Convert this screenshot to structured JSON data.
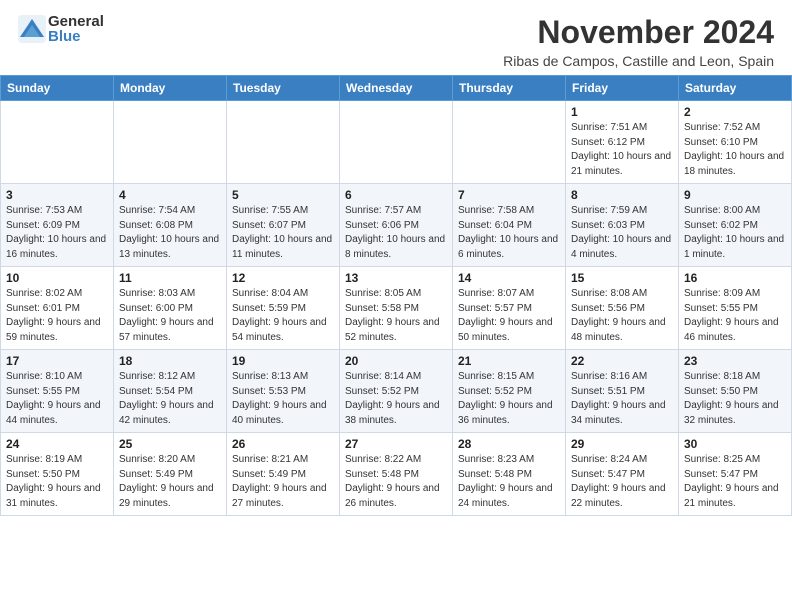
{
  "header": {
    "logo_general": "General",
    "logo_blue": "Blue",
    "month_title": "November 2024",
    "subtitle": "Ribas de Campos, Castille and Leon, Spain"
  },
  "weekdays": [
    "Sunday",
    "Monday",
    "Tuesday",
    "Wednesday",
    "Thursday",
    "Friday",
    "Saturday"
  ],
  "weeks": [
    [
      {
        "day": "",
        "info": ""
      },
      {
        "day": "",
        "info": ""
      },
      {
        "day": "",
        "info": ""
      },
      {
        "day": "",
        "info": ""
      },
      {
        "day": "",
        "info": ""
      },
      {
        "day": "1",
        "info": "Sunrise: 7:51 AM\nSunset: 6:12 PM\nDaylight: 10 hours and 21 minutes."
      },
      {
        "day": "2",
        "info": "Sunrise: 7:52 AM\nSunset: 6:10 PM\nDaylight: 10 hours and 18 minutes."
      }
    ],
    [
      {
        "day": "3",
        "info": "Sunrise: 7:53 AM\nSunset: 6:09 PM\nDaylight: 10 hours and 16 minutes."
      },
      {
        "day": "4",
        "info": "Sunrise: 7:54 AM\nSunset: 6:08 PM\nDaylight: 10 hours and 13 minutes."
      },
      {
        "day": "5",
        "info": "Sunrise: 7:55 AM\nSunset: 6:07 PM\nDaylight: 10 hours and 11 minutes."
      },
      {
        "day": "6",
        "info": "Sunrise: 7:57 AM\nSunset: 6:06 PM\nDaylight: 10 hours and 8 minutes."
      },
      {
        "day": "7",
        "info": "Sunrise: 7:58 AM\nSunset: 6:04 PM\nDaylight: 10 hours and 6 minutes."
      },
      {
        "day": "8",
        "info": "Sunrise: 7:59 AM\nSunset: 6:03 PM\nDaylight: 10 hours and 4 minutes."
      },
      {
        "day": "9",
        "info": "Sunrise: 8:00 AM\nSunset: 6:02 PM\nDaylight: 10 hours and 1 minute."
      }
    ],
    [
      {
        "day": "10",
        "info": "Sunrise: 8:02 AM\nSunset: 6:01 PM\nDaylight: 9 hours and 59 minutes."
      },
      {
        "day": "11",
        "info": "Sunrise: 8:03 AM\nSunset: 6:00 PM\nDaylight: 9 hours and 57 minutes."
      },
      {
        "day": "12",
        "info": "Sunrise: 8:04 AM\nSunset: 5:59 PM\nDaylight: 9 hours and 54 minutes."
      },
      {
        "day": "13",
        "info": "Sunrise: 8:05 AM\nSunset: 5:58 PM\nDaylight: 9 hours and 52 minutes."
      },
      {
        "day": "14",
        "info": "Sunrise: 8:07 AM\nSunset: 5:57 PM\nDaylight: 9 hours and 50 minutes."
      },
      {
        "day": "15",
        "info": "Sunrise: 8:08 AM\nSunset: 5:56 PM\nDaylight: 9 hours and 48 minutes."
      },
      {
        "day": "16",
        "info": "Sunrise: 8:09 AM\nSunset: 5:55 PM\nDaylight: 9 hours and 46 minutes."
      }
    ],
    [
      {
        "day": "17",
        "info": "Sunrise: 8:10 AM\nSunset: 5:55 PM\nDaylight: 9 hours and 44 minutes."
      },
      {
        "day": "18",
        "info": "Sunrise: 8:12 AM\nSunset: 5:54 PM\nDaylight: 9 hours and 42 minutes."
      },
      {
        "day": "19",
        "info": "Sunrise: 8:13 AM\nSunset: 5:53 PM\nDaylight: 9 hours and 40 minutes."
      },
      {
        "day": "20",
        "info": "Sunrise: 8:14 AM\nSunset: 5:52 PM\nDaylight: 9 hours and 38 minutes."
      },
      {
        "day": "21",
        "info": "Sunrise: 8:15 AM\nSunset: 5:52 PM\nDaylight: 9 hours and 36 minutes."
      },
      {
        "day": "22",
        "info": "Sunrise: 8:16 AM\nSunset: 5:51 PM\nDaylight: 9 hours and 34 minutes."
      },
      {
        "day": "23",
        "info": "Sunrise: 8:18 AM\nSunset: 5:50 PM\nDaylight: 9 hours and 32 minutes."
      }
    ],
    [
      {
        "day": "24",
        "info": "Sunrise: 8:19 AM\nSunset: 5:50 PM\nDaylight: 9 hours and 31 minutes."
      },
      {
        "day": "25",
        "info": "Sunrise: 8:20 AM\nSunset: 5:49 PM\nDaylight: 9 hours and 29 minutes."
      },
      {
        "day": "26",
        "info": "Sunrise: 8:21 AM\nSunset: 5:49 PM\nDaylight: 9 hours and 27 minutes."
      },
      {
        "day": "27",
        "info": "Sunrise: 8:22 AM\nSunset: 5:48 PM\nDaylight: 9 hours and 26 minutes."
      },
      {
        "day": "28",
        "info": "Sunrise: 8:23 AM\nSunset: 5:48 PM\nDaylight: 9 hours and 24 minutes."
      },
      {
        "day": "29",
        "info": "Sunrise: 8:24 AM\nSunset: 5:47 PM\nDaylight: 9 hours and 22 minutes."
      },
      {
        "day": "30",
        "info": "Sunrise: 8:25 AM\nSunset: 5:47 PM\nDaylight: 9 hours and 21 minutes."
      }
    ]
  ]
}
